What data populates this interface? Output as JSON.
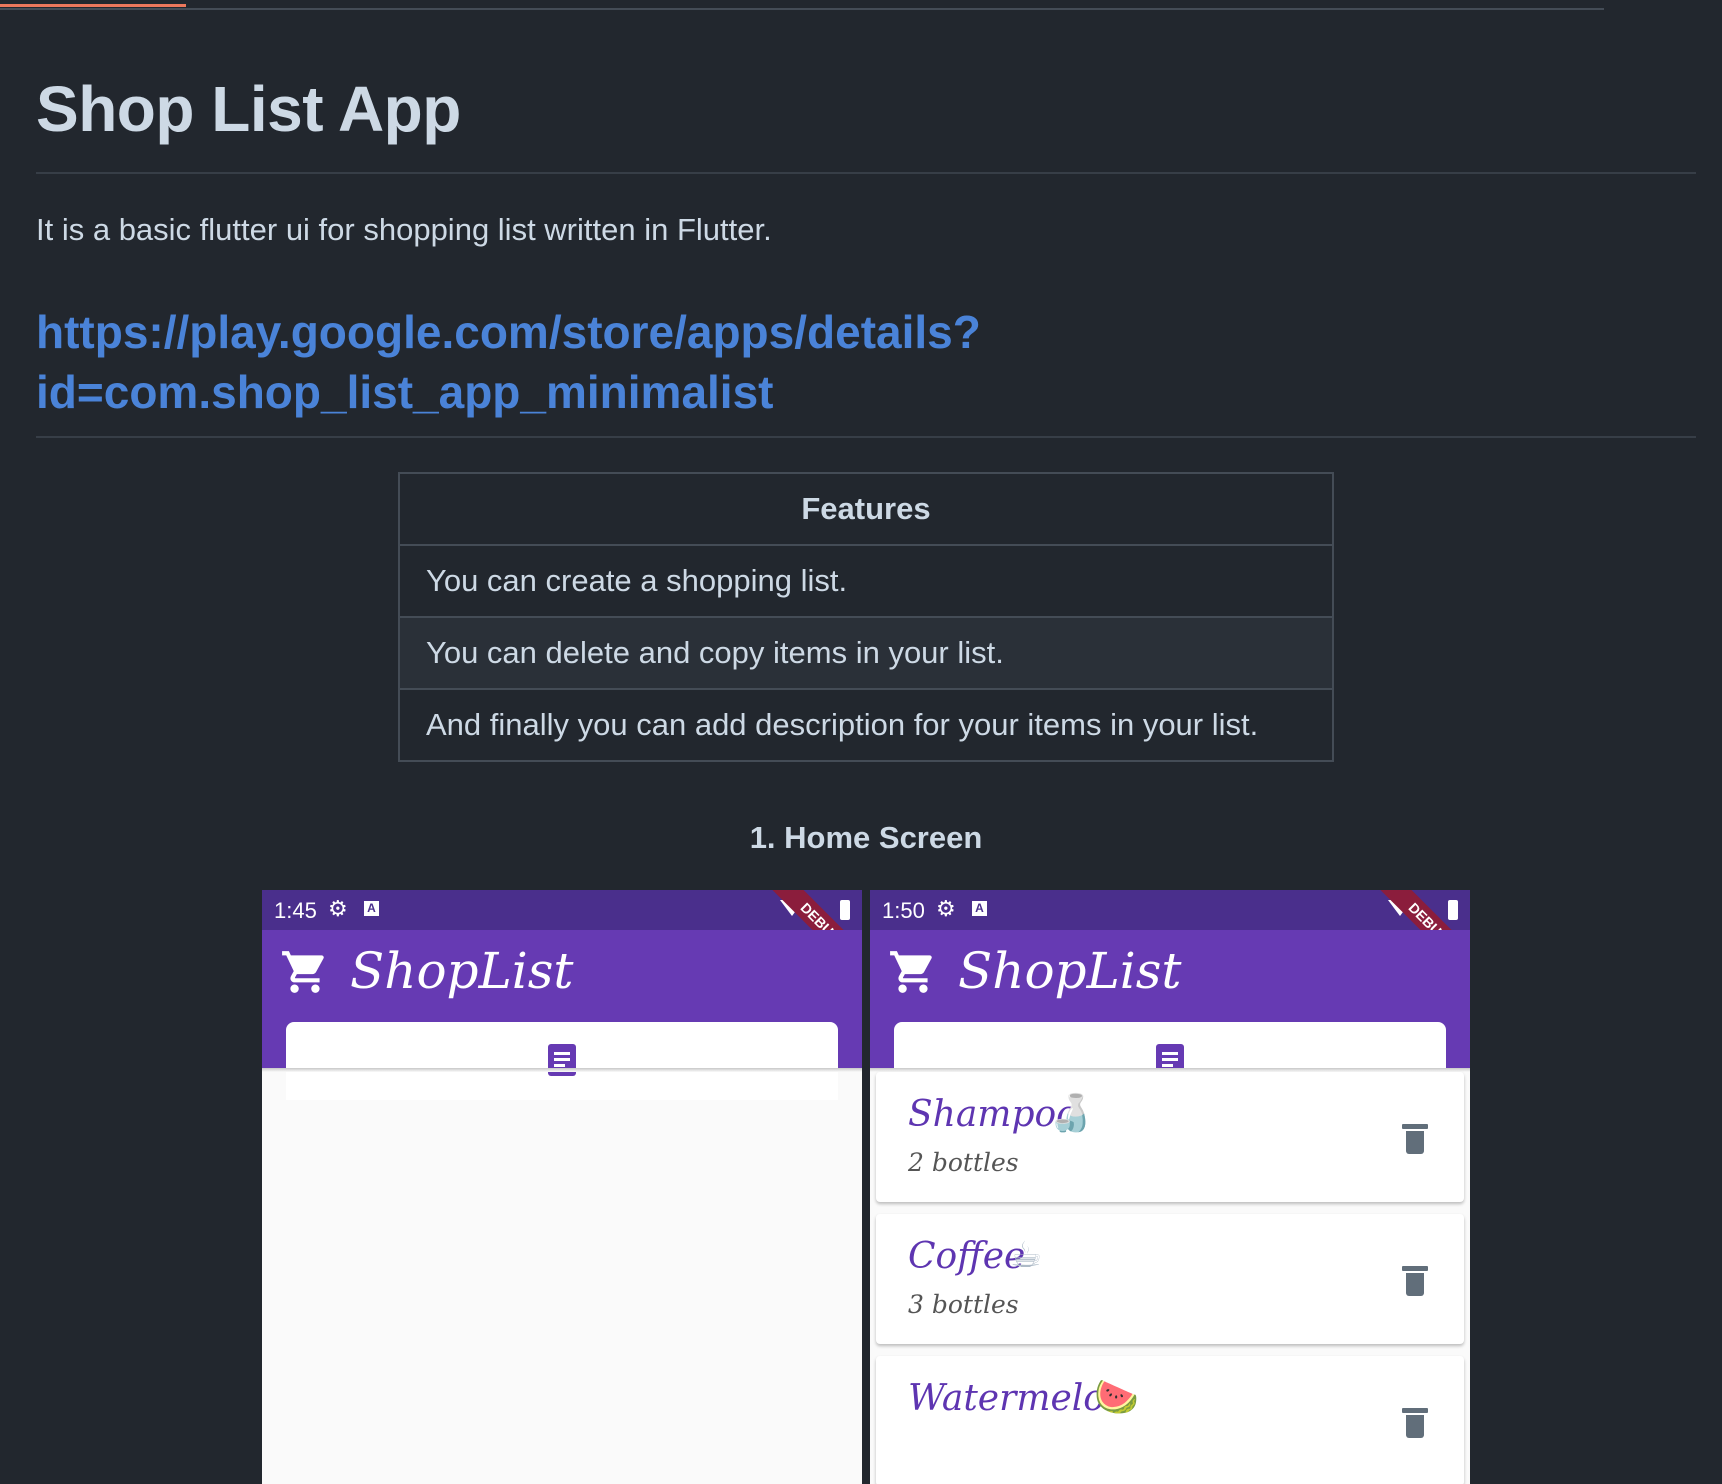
{
  "readme": {
    "title": "Shop List App",
    "description": "It is a basic flutter ui for shopping list written in Flutter.",
    "link_line1": "https://play.google.com/store/apps/details?",
    "link_line2": "id=com.shop_list_app_minimalist"
  },
  "features_table": {
    "header": "Features",
    "rows": [
      "You can create a shopping list.",
      "You can delete and copy items in your list.",
      "And finally you can add description for your items in your list."
    ]
  },
  "section_title": "1. Home Screen",
  "phones": [
    {
      "time": "1:45",
      "app_title": "ShopList",
      "debug_label": "DEBUG",
      "items": []
    },
    {
      "time": "1:50",
      "app_title": "ShopList",
      "debug_label": "DEBUG",
      "items": [
        {
          "name": "Shampoo",
          "emoji": "🍶",
          "quantity": "2 bottles"
        },
        {
          "name": "Coffee",
          "emoji": "☕",
          "quantity": "3 bottles"
        },
        {
          "name": "Watermelon",
          "emoji": "🍉",
          "quantity": ""
        }
      ]
    }
  ],
  "icons": {
    "status_gear": "gear-icon",
    "status_a": "a-icon",
    "wifi": "wifi-icon",
    "battery": "battery-icon",
    "cart": "cart-icon",
    "list": "document-list-icon",
    "delete": "trash-icon"
  },
  "colors": {
    "page_bg": "#22272e",
    "link": "#4a83d8",
    "app_purple": "#663ab3",
    "status_purple": "#4a2f8c",
    "item_text": "#5e35b1",
    "trash": "#616e7a"
  }
}
